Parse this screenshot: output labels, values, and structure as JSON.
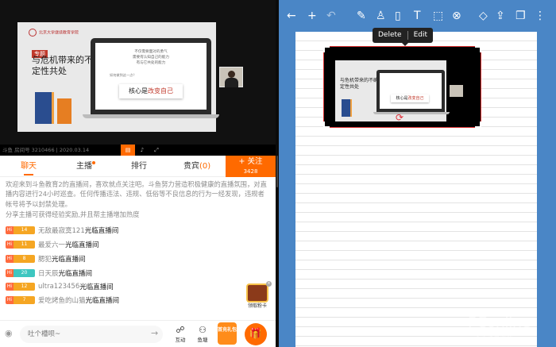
{
  "stream": {
    "slide": {
      "logo_text": "北京大学继续教育学院",
      "title_tag": "专题",
      "title": "与危机带来的不确定性共处",
      "question_lines": [
        "不仅需要面对的勇气",
        "需要有认知自己的能力",
        "有与它共处的能力"
      ],
      "question_highlight": "共处",
      "small_question": "如何做到这一点？",
      "core_prefix": "核心是",
      "core_highlight": "改变自己"
    },
    "room_info": "斗鱼 房间号 3210466 | 2020.03.14"
  },
  "tabs": [
    {
      "label": "聊天",
      "active": true
    },
    {
      "label": "主播",
      "dot": true
    },
    {
      "label": "排行"
    },
    {
      "label": "贵宾",
      "count": "(0)"
    }
  ],
  "follow": {
    "label": "+ 关注",
    "count": "3428"
  },
  "chat": {
    "notice": "欢迎来到斗鱼教育2的直播间，喜欢就点关注吧。斗鱼努力营造积极健康的直播氛围，对直播内容进行24小时巡查。任何传播违法、违规、低俗等不良信息的行为一经发现，违规者帐号将予以封禁处理。",
    "notice2": "分享主播可获得经验奖励,并且帮主播增加热度",
    "messages": [
      {
        "hi": "Hi",
        "level": "14",
        "user": "无敌最寂寞121",
        "action": "光临直播间",
        "color": "#f5a623"
      },
      {
        "hi": "Hi",
        "level": "11",
        "user": "最爱六一",
        "action": "光临直播间",
        "color": "#f5a623"
      },
      {
        "hi": "Hi",
        "level": "8",
        "user": "腮犯",
        "action": "光临直播间",
        "color": "#f5a623"
      },
      {
        "hi": "Hi",
        "level": "20",
        "user": "日天辰",
        "action": "光临直播间",
        "color": "#3ec6c0"
      },
      {
        "hi": "Hi",
        "level": "12",
        "user": "ultra123456",
        "action": "光临直播间",
        "color": "#f5a623"
      },
      {
        "hi": "Hi",
        "level": "7",
        "user": "爱吃烤鱼的山猫",
        "action": "光临直播间",
        "color": "#f5a623"
      }
    ],
    "card_label": "领取粉卡"
  },
  "bottom": {
    "input_placeholder": "吐个槽呗~",
    "interact_label": "互动",
    "fishball_label": "鱼塘",
    "gift_box_text": "首充礼包"
  },
  "notes": {
    "menu": {
      "delete": "Delete",
      "edit": "Edit"
    },
    "pasted_slide": {
      "title": "与危机带来的不确定性共处",
      "core_prefix": "核心是",
      "core_highlight": "改变自己"
    }
  },
  "watermark": {
    "brand": "PConline",
    "sub": "太平洋电脑网"
  },
  "colors": {
    "accent": "#ff6a00",
    "notes_toolbar": "#4a86c6",
    "selection": "#d33"
  }
}
